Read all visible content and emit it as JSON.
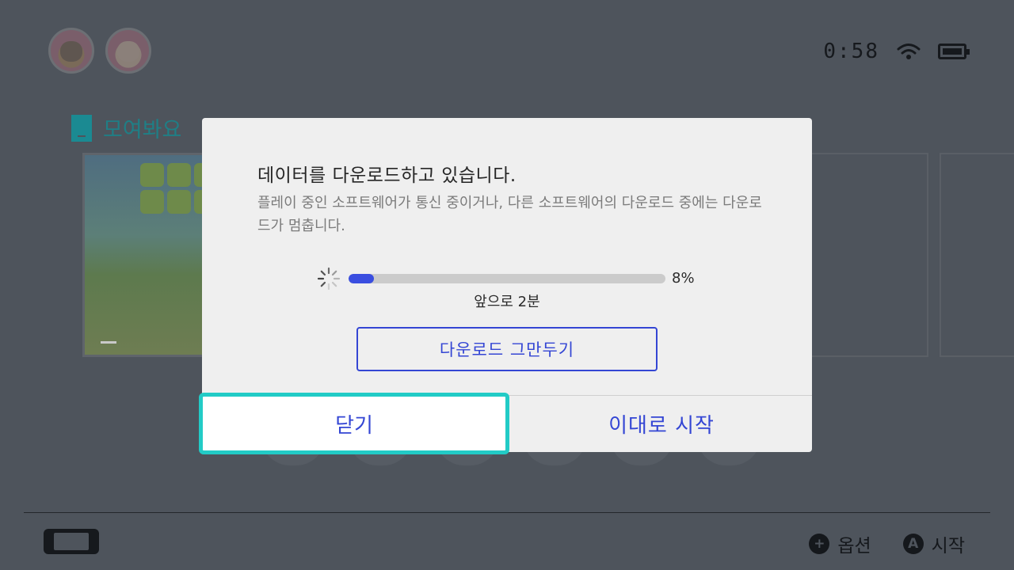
{
  "status": {
    "time": "0:58"
  },
  "game": {
    "title": "모여봐요"
  },
  "dialog": {
    "title": "데이터를 다운로드하고 있습니다.",
    "description": "플레이 중인 소프트웨어가 통신 중이거나, 다른 소프트웨어의 다운로드 중에는 다운로드가 멈춥니다.",
    "progress_fraction": 0.08,
    "progress_label": "8%",
    "time_remaining": "앞으로 2분",
    "cancel_download_label": "다운로드 그만두기",
    "close_label": "닫기",
    "start_label": "이대로 시작"
  },
  "footer": {
    "options_icon": "+",
    "options_label": "옵션",
    "start_icon": "A",
    "start_label": "시작"
  },
  "colors": {
    "accent_blue": "#3446d4",
    "focus_cyan": "#22cbc6",
    "progress_fill": "#3a4ee0"
  }
}
